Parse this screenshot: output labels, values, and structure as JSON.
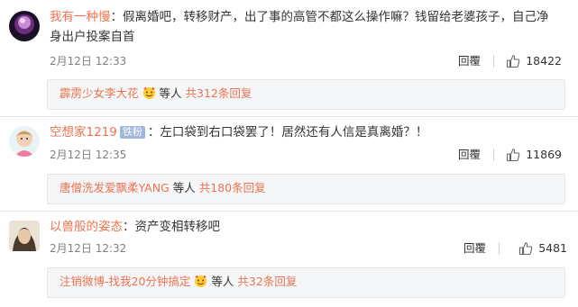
{
  "comments": [
    {
      "username": "我有一种慢",
      "text": "：假离婚吧，转移财产，出了事的高管不都这么操作嘛？钱留给老婆孩子，自己净身出户投案自首",
      "date": "2月12日 12:33",
      "reply_label": "回覆",
      "likes": "18422",
      "reply_user": "霹雳少女李大花",
      "reply_suffix": "等人",
      "reply_total": "共312条回复"
    },
    {
      "username": "空想家1219",
      "badge": "铁粉",
      "text": "：左口袋到右口袋罢了！居然还有人信是真离婚？！",
      "date": "2月12日 12:35",
      "reply_label": "回覆",
      "likes": "11869",
      "reply_user": "唐僧洗发爱飘柔YANG",
      "reply_suffix": "等人",
      "reply_total": "共180条回复"
    },
    {
      "username": "以兽般的姿态",
      "text": "：资产变相转移吧",
      "date": "2月12日 12:32",
      "reply_label": "回覆",
      "likes": "5481",
      "reply_user": "注销微博-找我20分钟搞定",
      "reply_suffix": "等人",
      "reply_total": "共32条回复"
    }
  ],
  "colors": {
    "username": "#eb7350",
    "badge": "#9fb6dd",
    "reply_box_bg": "#f5f6f8"
  }
}
